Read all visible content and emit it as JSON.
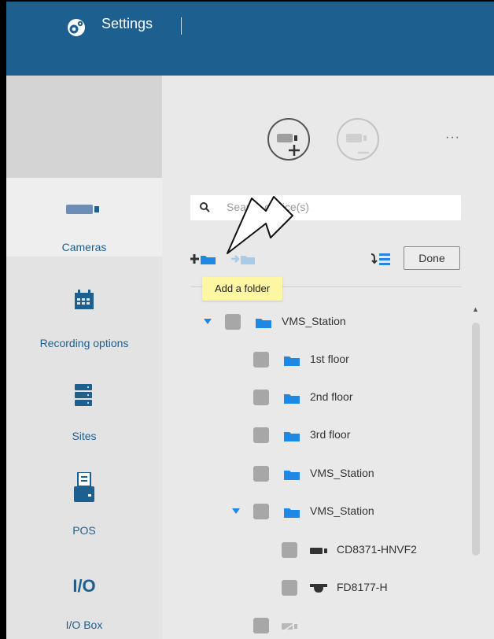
{
  "header": {
    "title": "Settings",
    "icon": "gear-icon"
  },
  "sidebar": {
    "items": [
      {
        "label": "Cameras",
        "icon": "camera-icon",
        "active": true
      },
      {
        "label": "Recording options",
        "icon": "calendar-icon",
        "active": false
      },
      {
        "label": "Sites",
        "icon": "server-icon",
        "active": false
      },
      {
        "label": "POS",
        "icon": "pos-icon",
        "active": false
      },
      {
        "label": "I/O Box",
        "icon": "io-icon",
        "icon_text": "I/O",
        "active": false
      }
    ]
  },
  "main": {
    "search": {
      "placeholder": "Search device(s)",
      "value": ""
    },
    "toolbar": {
      "done_label": "Done"
    },
    "tooltip": "Add a folder",
    "tree": [
      {
        "label": "VMS_Station",
        "type": "folder",
        "level": 0,
        "expanded": true
      },
      {
        "label": "1st floor",
        "type": "folder",
        "level": 1
      },
      {
        "label": "2nd floor",
        "type": "folder",
        "level": 1
      },
      {
        "label": "3rd floor",
        "type": "folder",
        "level": 1
      },
      {
        "label": "VMS_Station",
        "type": "folder",
        "level": 1
      },
      {
        "label": "VMS_Station",
        "type": "folder",
        "level": 1,
        "expanded": true
      },
      {
        "label": "CD8371-HNVF2",
        "type": "camera-box",
        "level": 2
      },
      {
        "label": "FD8177-H",
        "type": "camera-dome",
        "level": 2
      },
      {
        "label": "",
        "type": "camera-disabled",
        "level": 1
      }
    ]
  },
  "colors": {
    "header": "#1d5f8f",
    "accent": "#1e88e5",
    "tooltip": "#fdf7a4",
    "sidebar_text": "#1d5f8f"
  }
}
